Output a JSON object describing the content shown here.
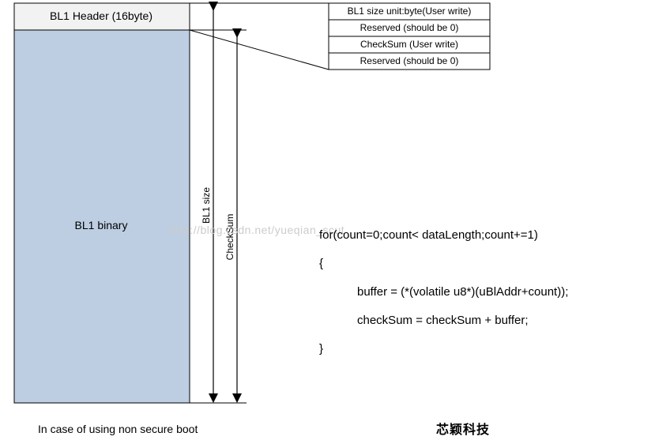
{
  "layout": {
    "header_label": "BL1 Header (16byte)",
    "binary_label": "BL1 binary"
  },
  "header_table": {
    "rows": [
      "BL1 size unit:byte(User write)",
      "Reserved (should be 0)",
      "CheckSum (User write)",
      "Reserved (should be 0)"
    ]
  },
  "arrows": {
    "bl1_size_label": "BL1 size",
    "checksum_label": "CheckSum"
  },
  "caption": "In case of using non secure boot",
  "brand": "芯颖科技",
  "watermark": "http://blog.csdn.net/yueqian_scut",
  "code": {
    "line1": "for(count=0;count< dataLength;count+=1)",
    "line2": "{",
    "line3": "buffer = (*(volatile u8*)(uBlAddr+count));",
    "line4": "checkSum = checkSum + buffer;",
    "line5": "}"
  }
}
